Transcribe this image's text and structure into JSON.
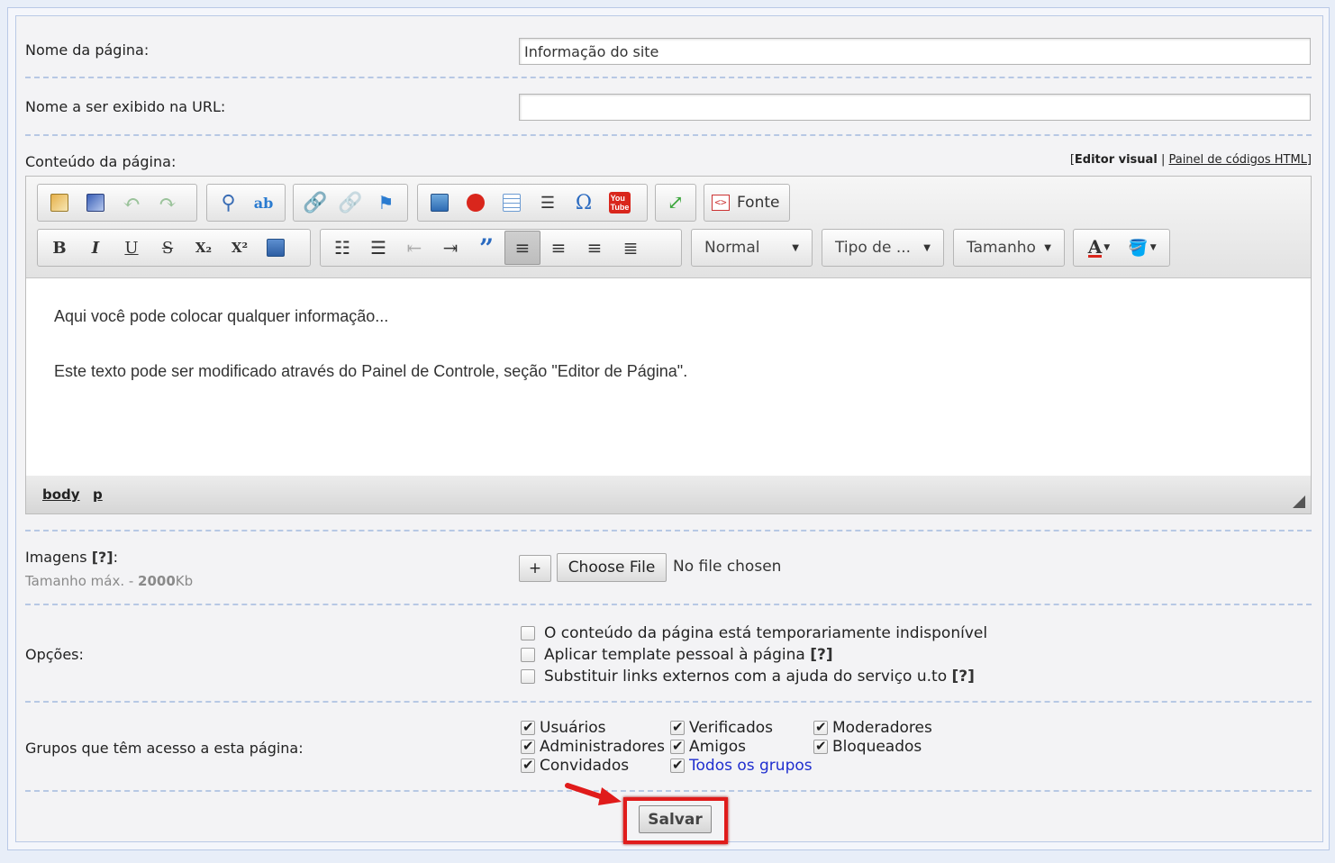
{
  "form": {
    "page_name_label": "Nome da página:",
    "page_name_value": "Informação do site",
    "url_name_label": "Nome a ser exibido na URL:",
    "url_name_value": "",
    "content_label": "Conteúdo da página:",
    "editor_switch": {
      "visual": "Editor visual",
      "separator": "|",
      "html": "Painel de códigos HTML",
      "open": "[",
      "close": "]"
    }
  },
  "toolbar": {
    "source_label": "Fonte",
    "format_label": "Normal",
    "font_label": "Tipo de ...",
    "size_label": "Tamanho",
    "bold": "B",
    "italic": "I",
    "underline": "U",
    "strike": "S",
    "subscript": "X₂",
    "superscript": "X²"
  },
  "editor_content": {
    "line1": "Aqui você pode colocar qualquer informação...",
    "line2": "Este texto pode ser modificado através do Painel de Controle, seção \"Editor de Página\"."
  },
  "statusbar": {
    "body": "body",
    "p": "p"
  },
  "images": {
    "label": "Imagens",
    "help": "[?]",
    "colon": ":",
    "max_size_prefix": "Tamanho máx. - ",
    "max_size_value": "2000",
    "max_size_unit": "Kb",
    "plus": "+",
    "choose_file": "Choose File",
    "no_file": "No file chosen"
  },
  "options": {
    "label": "Opções:",
    "items": [
      {
        "label": "O conteúdo da página está temporariamente indisponível",
        "help": ""
      },
      {
        "label": "Aplicar template pessoal à página",
        "help": "[?]"
      },
      {
        "label": "Substituir links externos com a ajuda do serviço u.to",
        "help": "[?]"
      }
    ]
  },
  "groups": {
    "label": "Grupos que têm acesso a esta página:",
    "items": [
      {
        "label": "Usuários"
      },
      {
        "label": "Verificados"
      },
      {
        "label": "Moderadores"
      },
      {
        "label": "Administradores"
      },
      {
        "label": "Amigos"
      },
      {
        "label": "Bloqueados"
      },
      {
        "label": "Convidados"
      },
      {
        "label": "Todos os grupos"
      }
    ]
  },
  "save_label": "Salvar",
  "colors": {
    "highlight": "#e01b1b",
    "link": "#1f2ecf",
    "separator": "#b7c8e4"
  }
}
